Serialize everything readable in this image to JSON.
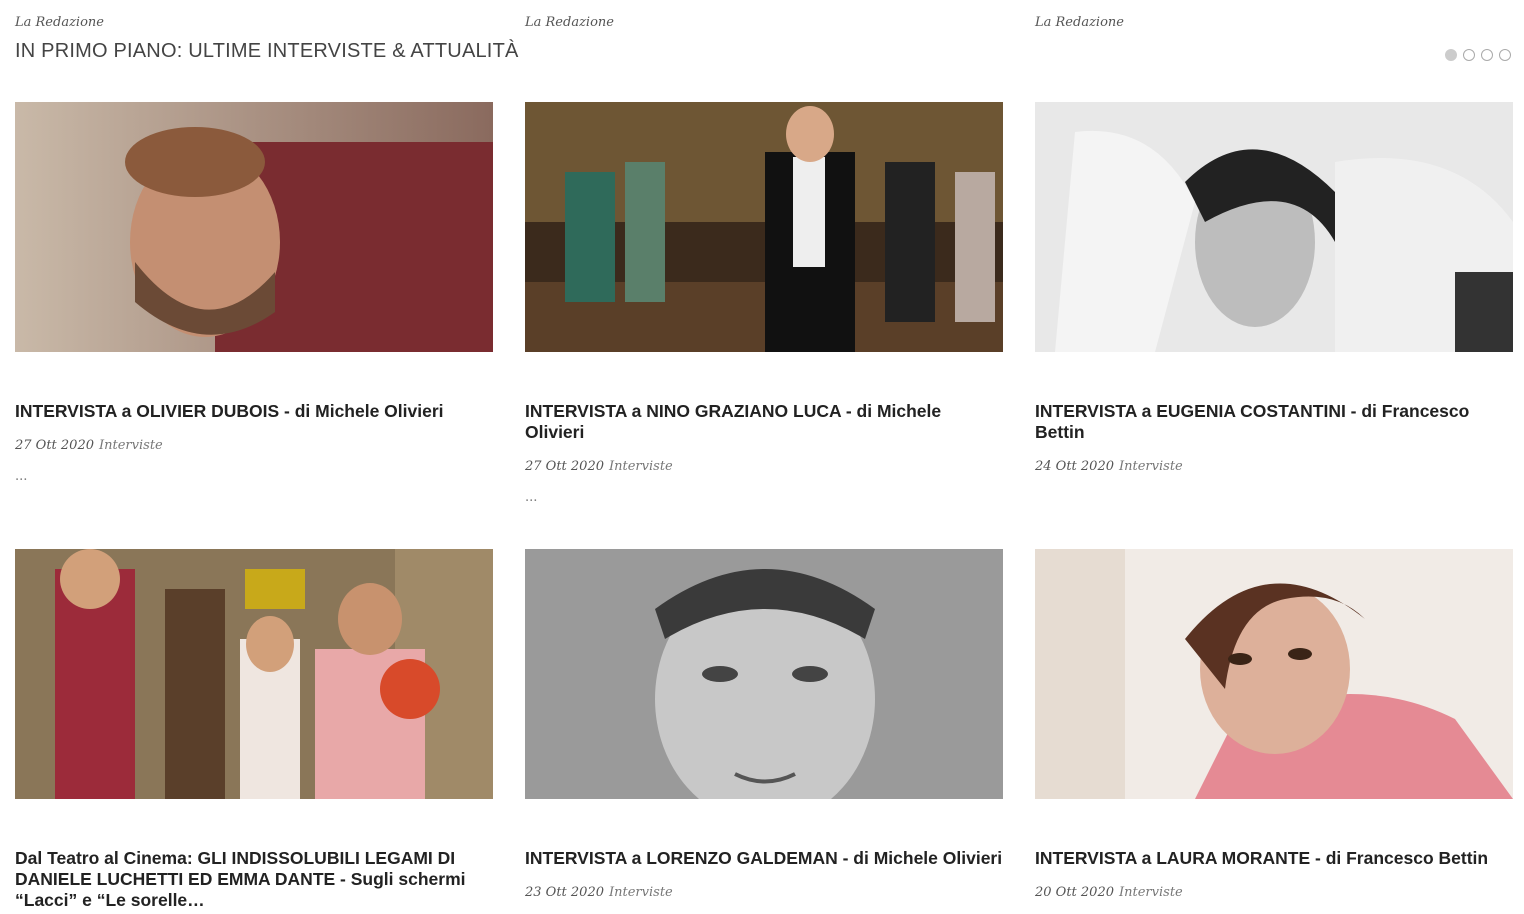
{
  "header": {
    "bylines": [
      "La Redazione",
      "La Redazione",
      "La Redazione"
    ],
    "section_title": "IN PRIMO PIANO: ULTIME INTERVISTE & ATTUALITÀ",
    "pagination_dots": 4,
    "active_dot": 1
  },
  "articles": [
    {
      "title": "INTERVISTA a OLIVIER DUBOIS - di Michele Olivieri",
      "date": "27 Ott 2020",
      "category": "Interviste",
      "excerpt": "..."
    },
    {
      "title": "INTERVISTA a NINO GRAZIANO LUCA - di Michele Olivieri",
      "date": "27 Ott 2020",
      "category": "Interviste",
      "excerpt": "..."
    },
    {
      "title": "INTERVISTA a EUGENIA COSTANTINI - di Francesco Bettin",
      "date": "24 Ott 2020",
      "category": "Interviste",
      "excerpt": ""
    },
    {
      "title": "Dal Teatro al Cinema: GLI INDISSOLUBILI LEGAMI DI DANIELE LUCHETTI ED EMMA DANTE - Sugli schermi “Lacci” e “Le sorelle…",
      "date": "",
      "category": "",
      "excerpt": ""
    },
    {
      "title": "INTERVISTA a LORENZO GALDEMAN - di Michele Olivieri",
      "date": "23 Ott 2020",
      "category": "Interviste",
      "excerpt": ""
    },
    {
      "title": "INTERVISTA a LAURA MORANTE - di Francesco Bettin",
      "date": "20 Ott 2020",
      "category": "Interviste",
      "excerpt": ""
    }
  ]
}
